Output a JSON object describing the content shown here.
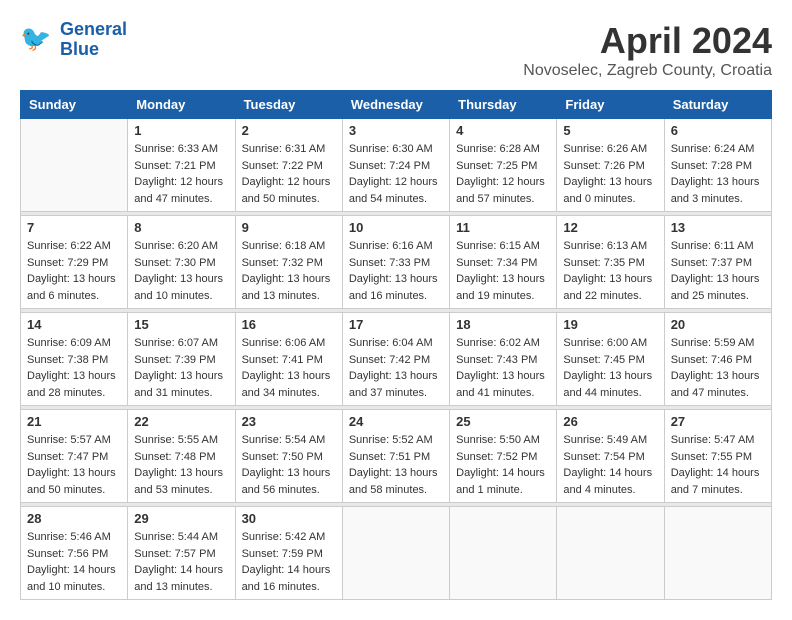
{
  "header": {
    "logo_line1": "General",
    "logo_line2": "Blue",
    "month_title": "April 2024",
    "location": "Novoselec, Zagreb County, Croatia"
  },
  "days_of_week": [
    "Sunday",
    "Monday",
    "Tuesday",
    "Wednesday",
    "Thursday",
    "Friday",
    "Saturday"
  ],
  "weeks": [
    [
      {
        "day": "",
        "info": ""
      },
      {
        "day": "1",
        "info": "Sunrise: 6:33 AM\nSunset: 7:21 PM\nDaylight: 12 hours\nand 47 minutes."
      },
      {
        "day": "2",
        "info": "Sunrise: 6:31 AM\nSunset: 7:22 PM\nDaylight: 12 hours\nand 50 minutes."
      },
      {
        "day": "3",
        "info": "Sunrise: 6:30 AM\nSunset: 7:24 PM\nDaylight: 12 hours\nand 54 minutes."
      },
      {
        "day": "4",
        "info": "Sunrise: 6:28 AM\nSunset: 7:25 PM\nDaylight: 12 hours\nand 57 minutes."
      },
      {
        "day": "5",
        "info": "Sunrise: 6:26 AM\nSunset: 7:26 PM\nDaylight: 13 hours\nand 0 minutes."
      },
      {
        "day": "6",
        "info": "Sunrise: 6:24 AM\nSunset: 7:28 PM\nDaylight: 13 hours\nand 3 minutes."
      }
    ],
    [
      {
        "day": "7",
        "info": "Sunrise: 6:22 AM\nSunset: 7:29 PM\nDaylight: 13 hours\nand 6 minutes."
      },
      {
        "day": "8",
        "info": "Sunrise: 6:20 AM\nSunset: 7:30 PM\nDaylight: 13 hours\nand 10 minutes."
      },
      {
        "day": "9",
        "info": "Sunrise: 6:18 AM\nSunset: 7:32 PM\nDaylight: 13 hours\nand 13 minutes."
      },
      {
        "day": "10",
        "info": "Sunrise: 6:16 AM\nSunset: 7:33 PM\nDaylight: 13 hours\nand 16 minutes."
      },
      {
        "day": "11",
        "info": "Sunrise: 6:15 AM\nSunset: 7:34 PM\nDaylight: 13 hours\nand 19 minutes."
      },
      {
        "day": "12",
        "info": "Sunrise: 6:13 AM\nSunset: 7:35 PM\nDaylight: 13 hours\nand 22 minutes."
      },
      {
        "day": "13",
        "info": "Sunrise: 6:11 AM\nSunset: 7:37 PM\nDaylight: 13 hours\nand 25 minutes."
      }
    ],
    [
      {
        "day": "14",
        "info": "Sunrise: 6:09 AM\nSunset: 7:38 PM\nDaylight: 13 hours\nand 28 minutes."
      },
      {
        "day": "15",
        "info": "Sunrise: 6:07 AM\nSunset: 7:39 PM\nDaylight: 13 hours\nand 31 minutes."
      },
      {
        "day": "16",
        "info": "Sunrise: 6:06 AM\nSunset: 7:41 PM\nDaylight: 13 hours\nand 34 minutes."
      },
      {
        "day": "17",
        "info": "Sunrise: 6:04 AM\nSunset: 7:42 PM\nDaylight: 13 hours\nand 37 minutes."
      },
      {
        "day": "18",
        "info": "Sunrise: 6:02 AM\nSunset: 7:43 PM\nDaylight: 13 hours\nand 41 minutes."
      },
      {
        "day": "19",
        "info": "Sunrise: 6:00 AM\nSunset: 7:45 PM\nDaylight: 13 hours\nand 44 minutes."
      },
      {
        "day": "20",
        "info": "Sunrise: 5:59 AM\nSunset: 7:46 PM\nDaylight: 13 hours\nand 47 minutes."
      }
    ],
    [
      {
        "day": "21",
        "info": "Sunrise: 5:57 AM\nSunset: 7:47 PM\nDaylight: 13 hours\nand 50 minutes."
      },
      {
        "day": "22",
        "info": "Sunrise: 5:55 AM\nSunset: 7:48 PM\nDaylight: 13 hours\nand 53 minutes."
      },
      {
        "day": "23",
        "info": "Sunrise: 5:54 AM\nSunset: 7:50 PM\nDaylight: 13 hours\nand 56 minutes."
      },
      {
        "day": "24",
        "info": "Sunrise: 5:52 AM\nSunset: 7:51 PM\nDaylight: 13 hours\nand 58 minutes."
      },
      {
        "day": "25",
        "info": "Sunrise: 5:50 AM\nSunset: 7:52 PM\nDaylight: 14 hours\nand 1 minute."
      },
      {
        "day": "26",
        "info": "Sunrise: 5:49 AM\nSunset: 7:54 PM\nDaylight: 14 hours\nand 4 minutes."
      },
      {
        "day": "27",
        "info": "Sunrise: 5:47 AM\nSunset: 7:55 PM\nDaylight: 14 hours\nand 7 minutes."
      }
    ],
    [
      {
        "day": "28",
        "info": "Sunrise: 5:46 AM\nSunset: 7:56 PM\nDaylight: 14 hours\nand 10 minutes."
      },
      {
        "day": "29",
        "info": "Sunrise: 5:44 AM\nSunset: 7:57 PM\nDaylight: 14 hours\nand 13 minutes."
      },
      {
        "day": "30",
        "info": "Sunrise: 5:42 AM\nSunset: 7:59 PM\nDaylight: 14 hours\nand 16 minutes."
      },
      {
        "day": "",
        "info": ""
      },
      {
        "day": "",
        "info": ""
      },
      {
        "day": "",
        "info": ""
      },
      {
        "day": "",
        "info": ""
      }
    ]
  ]
}
